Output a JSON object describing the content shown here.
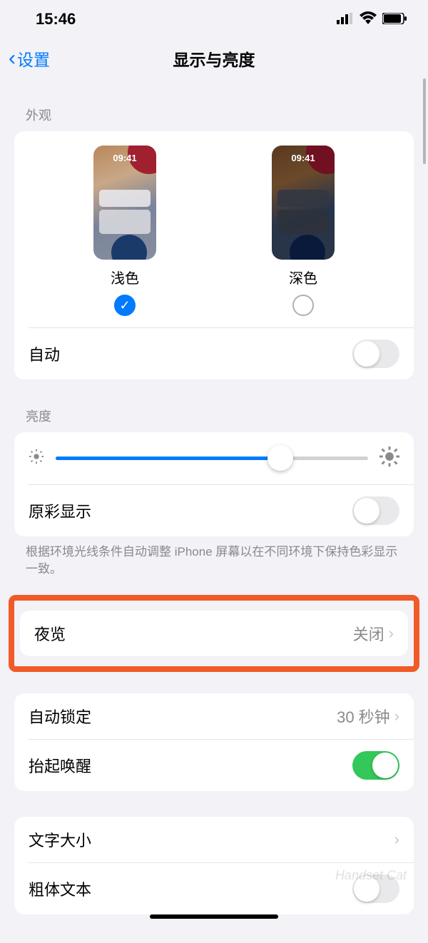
{
  "status": {
    "time": "15:46"
  },
  "nav": {
    "back": "设置",
    "title": "显示与亮度"
  },
  "appearance": {
    "header": "外观",
    "preview_time": "09:41",
    "light_label": "浅色",
    "dark_label": "深色",
    "auto_label": "自动",
    "auto_on": false,
    "selected": "light"
  },
  "brightness": {
    "header": "亮度",
    "value_percent": 72,
    "true_tone_label": "原彩显示",
    "true_tone_on": false,
    "footer": "根据环境光线条件自动调整 iPhone 屏幕以在不同环境下保持色彩显示一致。"
  },
  "night_shift": {
    "label": "夜览",
    "value": "关闭"
  },
  "lock": {
    "auto_lock_label": "自动锁定",
    "auto_lock_value": "30 秒钟",
    "raise_label": "抬起唤醒",
    "raise_on": true
  },
  "text": {
    "size_label": "文字大小",
    "bold_label": "粗体文本",
    "bold_on": false
  },
  "watermark": "Handset Cat"
}
